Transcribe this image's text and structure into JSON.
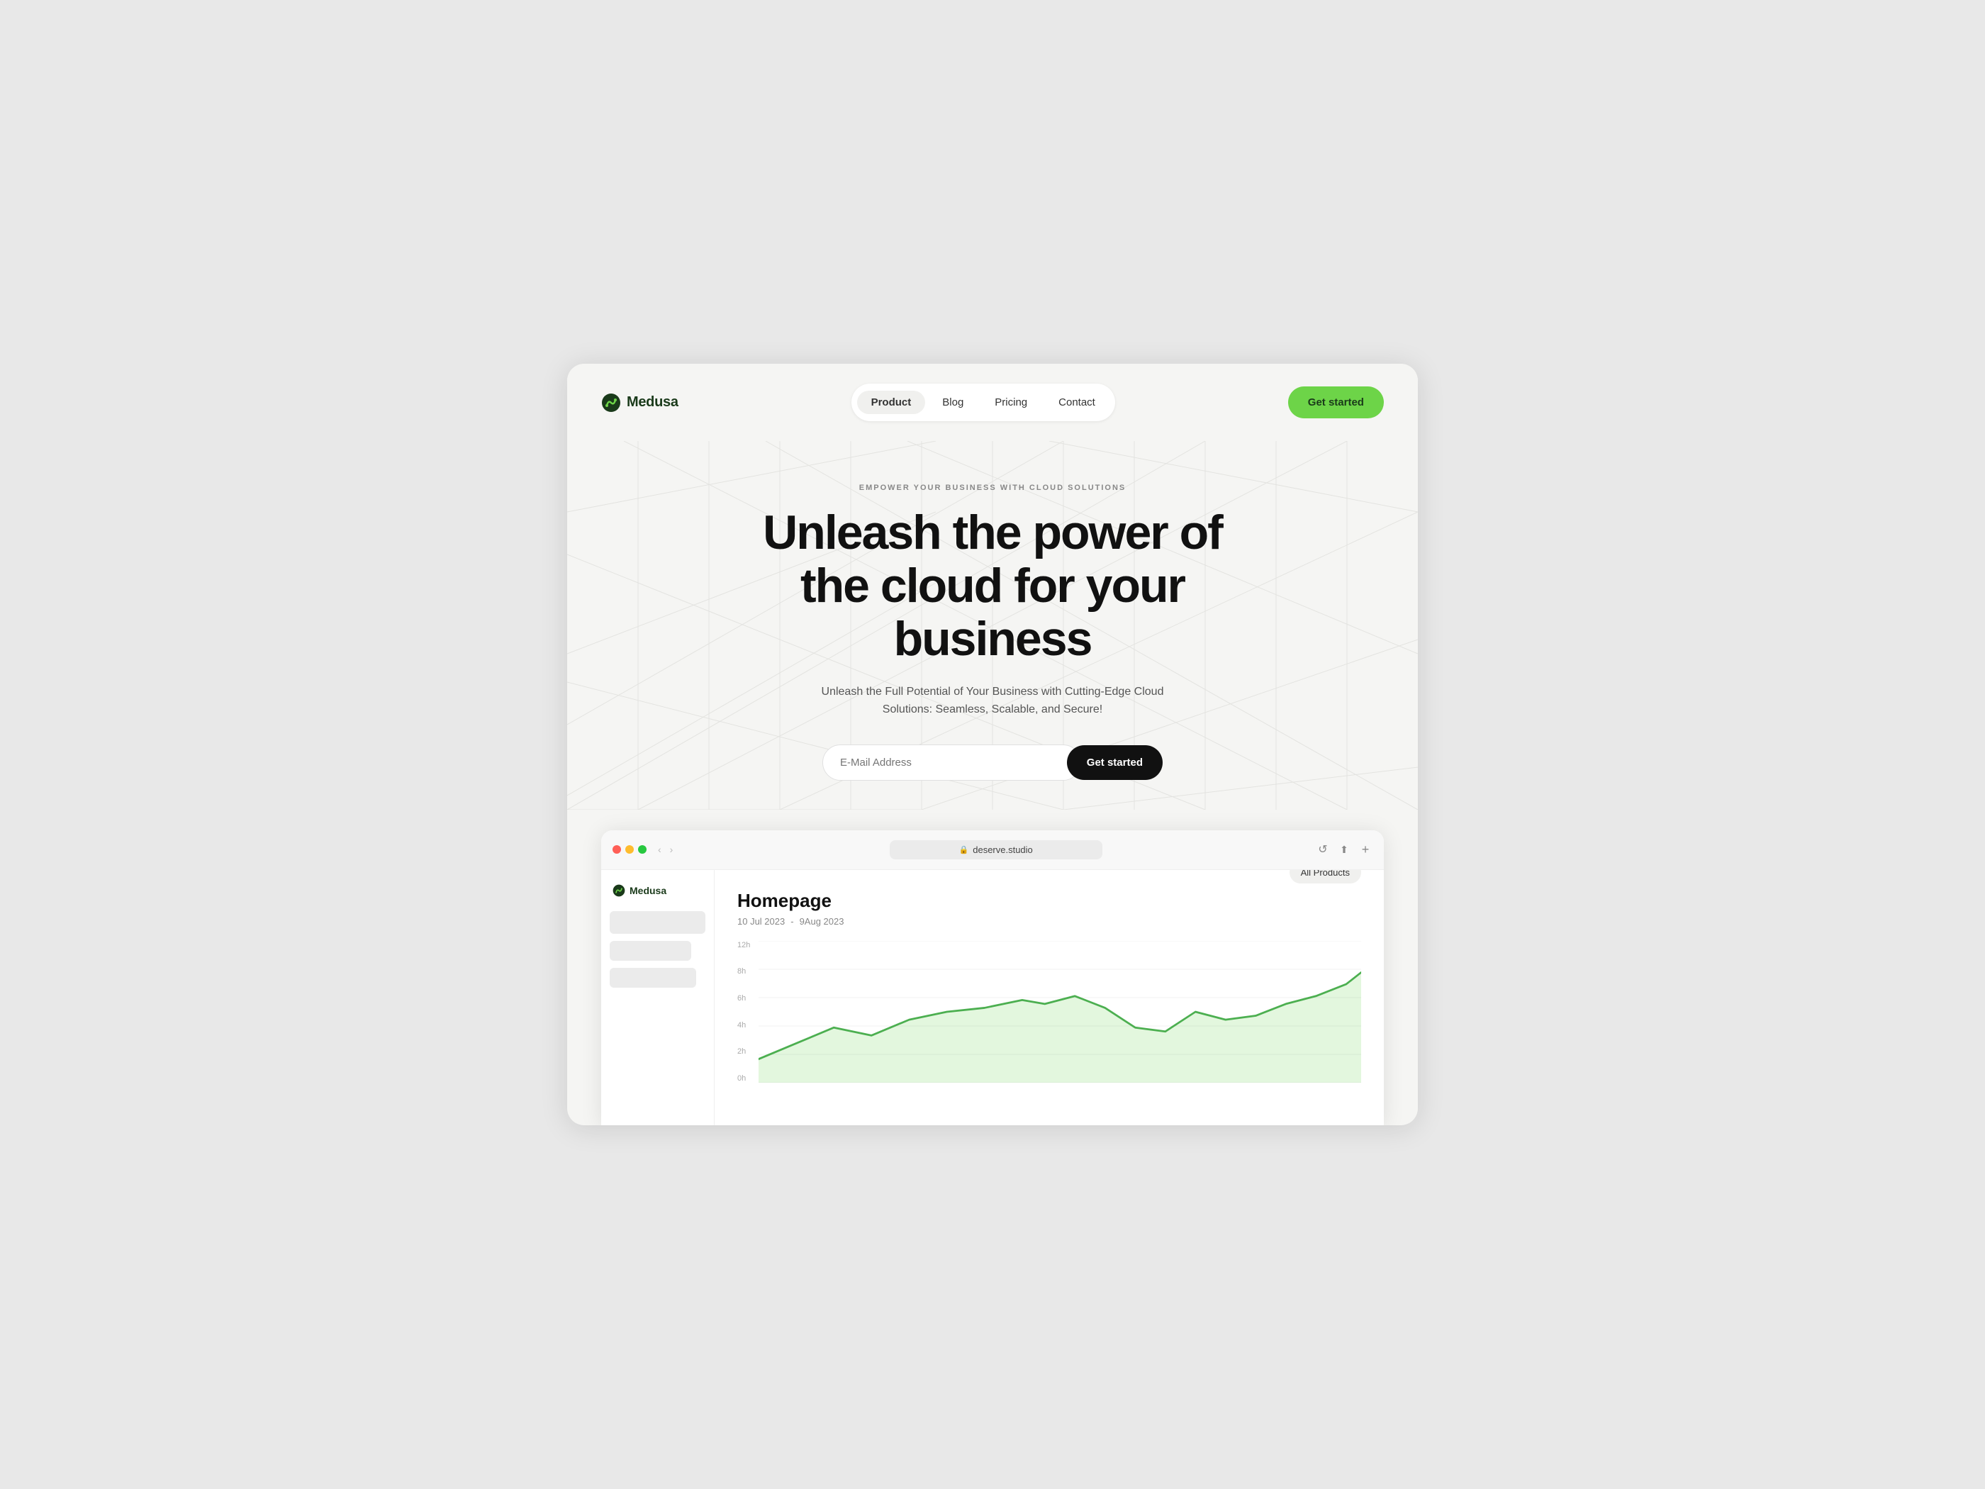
{
  "brand": {
    "name": "Medusa",
    "logo_alt": "Medusa logo"
  },
  "nav": {
    "links": [
      {
        "label": "Product",
        "active": true
      },
      {
        "label": "Blog",
        "active": false
      },
      {
        "label": "Pricing",
        "active": false
      },
      {
        "label": "Contact",
        "active": false
      }
    ],
    "cta_label": "Get started"
  },
  "hero": {
    "tagline": "Empower your business with cloud solutions",
    "title_line1": "Unleash the power of",
    "title_line2": "the cloud for your business",
    "subtitle": "Unleash the Full Potential of Your Business with Cutting-Edge Cloud Solutions: Seamless, Scalable, and Secure!",
    "email_placeholder": "E-Mail Address",
    "cta_label": "Get started"
  },
  "browser": {
    "url": "deserve.studio",
    "refresh_icon": "↺",
    "share_icon": "⬆",
    "add_icon": "+"
  },
  "sidebar": {
    "logo_text": "Medusa"
  },
  "dashboard": {
    "title": "Homepage",
    "date_from": "10 Jul 2023",
    "date_separator": "-",
    "date_to": "9Aug 2023",
    "filter_label": "All Products",
    "chart_labels": [
      "12h",
      "8h",
      "6h",
      "4h",
      "2h",
      "0h"
    ],
    "chart_color": "#4caf50",
    "chart_fill": "rgba(100,200,80,0.15)"
  },
  "colors": {
    "accent_green": "#6dd448",
    "dark_green": "#1a3a1a",
    "chart_green": "#4caf50"
  }
}
